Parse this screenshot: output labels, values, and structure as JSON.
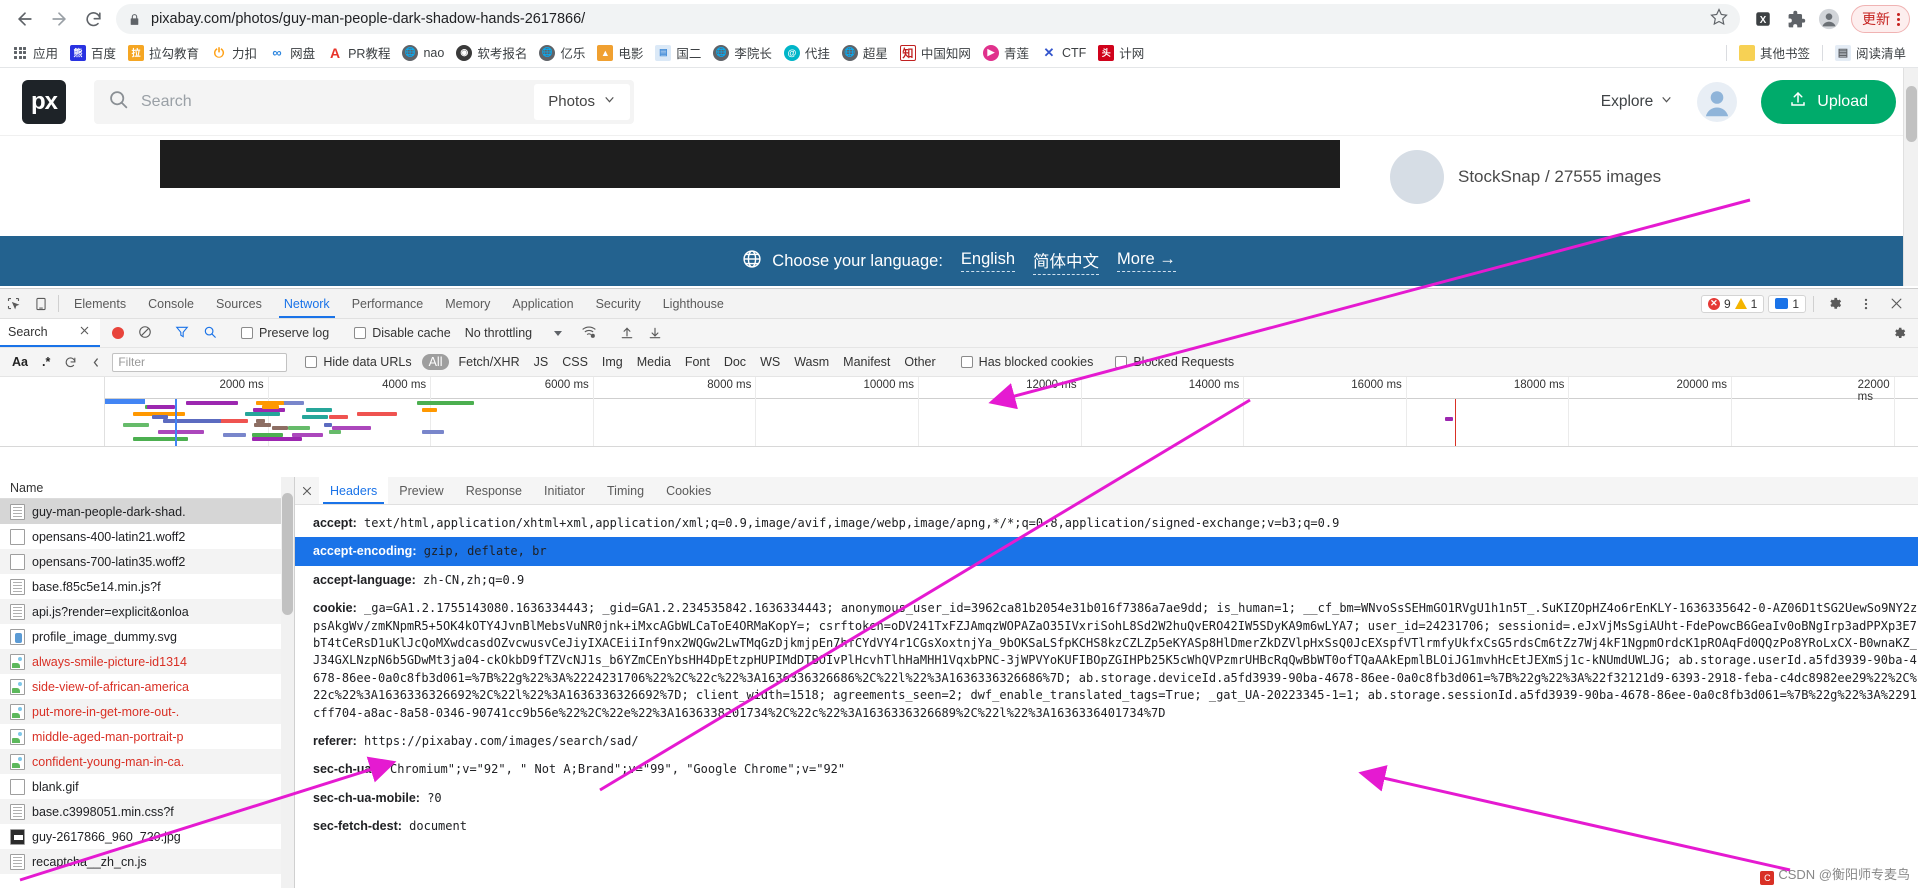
{
  "browser": {
    "back_label": "Back",
    "forward_label": "Forward",
    "reload_label": "Reload",
    "url": "pixabay.com/photos/guy-man-people-dark-shadow-hands-2617866/",
    "star_label": "Bookmark this tab",
    "update_label": "更新",
    "extensions_label": "Extensions",
    "profile_label": "Profile"
  },
  "bookmarks": {
    "items": [
      {
        "label": "应用",
        "icon": "apps-grid-icon",
        "color": "#5f6368"
      },
      {
        "label": "百度",
        "icon": "baidu-icon",
        "color": "#2932e1"
      },
      {
        "label": "拉勾教育",
        "icon": "lagou-icon",
        "color": "#f5a623"
      },
      {
        "label": "力扣",
        "icon": "leetcode-icon",
        "color": "#ffa116"
      },
      {
        "label": "网盘",
        "icon": "baidu-pan-icon",
        "color": "#2e86de"
      },
      {
        "label": "PR教程",
        "icon": "adobe-icon",
        "color": "#e8342a"
      },
      {
        "label": "nao",
        "icon": "globe-icon",
        "color": "#5f6368"
      },
      {
        "label": "软考报名",
        "icon": "globe-dark-icon",
        "color": "#3a3a3a"
      },
      {
        "label": "亿乐",
        "icon": "globe-icon",
        "color": "#5f6368"
      },
      {
        "label": "电影",
        "icon": "folder-blue-icon",
        "color": "#f0a030"
      },
      {
        "label": "国二",
        "icon": "doc-icon",
        "color": "#4a90d9"
      },
      {
        "label": "李院长",
        "icon": "globe-icon",
        "color": "#5f6368"
      },
      {
        "label": "代挂",
        "icon": "circle-teal-icon",
        "color": "#00b5c8"
      },
      {
        "label": "超星",
        "icon": "globe-icon",
        "color": "#5f6368"
      },
      {
        "label": "中国知网",
        "icon": "cnki-icon",
        "color": "#c02020"
      },
      {
        "label": "青莲",
        "icon": "play-circle-icon",
        "color": "#e0318c"
      },
      {
        "label": "CTF",
        "icon": "x-mark-icon",
        "color": "#3355cc"
      },
      {
        "label": "计网",
        "icon": "red-badge-icon",
        "color": "#d0021b"
      }
    ],
    "other_bookmarks": "其他书签",
    "reading_list": "阅读清单"
  },
  "pixabay": {
    "logo": "px",
    "search_placeholder": "Search",
    "search_value": "",
    "media_type": "Photos",
    "explore": "Explore",
    "upload": "Upload",
    "credit": "StockSnap / 27555 images",
    "language_bar": {
      "prompt": "Choose your language:",
      "options": [
        "English",
        "简体中文",
        "More →"
      ]
    }
  },
  "devtools": {
    "tabs": [
      "Elements",
      "Console",
      "Sources",
      "Network",
      "Performance",
      "Memory",
      "Application",
      "Security",
      "Lighthouse"
    ],
    "active_tab": "Network",
    "error_count": "9",
    "warning_count": "1",
    "info_count": "1",
    "settings_label": "Settings",
    "more_label": "More options",
    "close_label": "Close DevTools",
    "toolbar": {
      "search_tab": "Search",
      "record_label": "Stop recording network log",
      "clear_label": "Clear",
      "filter_label": "Filter",
      "search_label": "Search",
      "preserve_log": "Preserve log",
      "preserve_log_checked": false,
      "disable_cache": "Disable cache",
      "disable_cache_checked": false,
      "throttling": "No throttling",
      "import_label": "Import HAR file",
      "export_label": "Export HAR file"
    },
    "filterbar": {
      "match_case": "Aa",
      "regex": ".*",
      "refresh_label": "Refresh",
      "filter_placeholder": "Filter",
      "filter_value": "",
      "hide_data_urls": "Hide data URLs",
      "hide_data_urls_checked": false,
      "types": [
        "All",
        "Fetch/XHR",
        "JS",
        "CSS",
        "Img",
        "Media",
        "Font",
        "Doc",
        "WS",
        "Wasm",
        "Manifest",
        "Other"
      ],
      "active_type": "All",
      "has_blocked_cookies": "Has blocked cookies",
      "has_blocked_cookies_checked": false,
      "blocked_requests": "Blocked Requests",
      "blocked_requests_checked": false
    },
    "overview": {
      "ticks": [
        "2000 ms",
        "4000 ms",
        "6000 ms",
        "8000 ms",
        "10000 ms",
        "12000 ms",
        "14000 ms",
        "16000 ms",
        "18000 ms",
        "20000 ms",
        "22000 ms"
      ]
    },
    "requests": {
      "column_header": "Name",
      "rows": [
        {
          "name": "guy-man-people-dark-shad.",
          "icon": "doc-icon",
          "state": "selected"
        },
        {
          "name": "opensans-400-latin21.woff2",
          "icon": "blank-icon",
          "state": "normal"
        },
        {
          "name": "opensans-700-latin35.woff2",
          "icon": "blank-icon",
          "state": "normal"
        },
        {
          "name": "base.f85c5e14.min.js?f",
          "icon": "doc-icon",
          "state": "normal"
        },
        {
          "name": "api.js?render=explicit&onloa",
          "icon": "doc-icon",
          "state": "normal"
        },
        {
          "name": "profile_image_dummy.svg",
          "icon": "svg-icon",
          "state": "normal"
        },
        {
          "name": "always-smile-picture-id1314",
          "icon": "img-icon",
          "state": "error"
        },
        {
          "name": "side-view-of-african-america",
          "icon": "img-icon",
          "state": "error"
        },
        {
          "name": "put-more-in-get-more-out-.",
          "icon": "img-icon",
          "state": "error"
        },
        {
          "name": "middle-aged-man-portrait-p",
          "icon": "img-icon",
          "state": "error"
        },
        {
          "name": "confident-young-man-in-ca.",
          "icon": "img-icon",
          "state": "error"
        },
        {
          "name": "blank.gif",
          "icon": "blank-icon",
          "state": "normal"
        },
        {
          "name": "base.c3998051.min.css?f",
          "icon": "doc-icon",
          "state": "normal"
        },
        {
          "name": "guy-2617866_960_720.jpg",
          "icon": "jpg-icon",
          "state": "normal"
        },
        {
          "name": "recaptcha__zh_cn.js",
          "icon": "doc-icon",
          "state": "normal"
        }
      ]
    },
    "detail": {
      "tabs": [
        "Headers",
        "Preview",
        "Response",
        "Initiator",
        "Timing",
        "Cookies"
      ],
      "active_tab": "Headers",
      "headers": [
        {
          "key": "accept",
          "value": "text/html,application/xhtml+xml,application/xml;q=0.9,image/avif,image/webp,image/apng,*/*;q=0.8,application/signed-exchange;v=b3;q=0.9",
          "selected": false
        },
        {
          "key": "accept-encoding",
          "value": "gzip, deflate, br",
          "selected": true
        },
        {
          "key": "accept-language",
          "value": "zh-CN,zh;q=0.9",
          "selected": false
        },
        {
          "key": "cookie",
          "value": "_ga=GA1.2.1755143080.1636334443; _gid=GA1.2.234535842.1636334443; anonymous_user_id=3962ca81b2054e31b016f7386a7ae9dd; is_human=1; __cf_bm=WNvoSsSEHmGO1RVgU1h1n5T_.SuKIZOpHZ4o6rEnKLY-1636335642-0-AZ06D1tSG2UewSo9NY2zpsAkgWv/zmKNpmR5+5OK4kOTY4JvnBlMebsVuNR0jnk+iMxcAGbWLCaToE4ORMaKopY=; csrftoken=oDV241TxFZJAmqzWOPAZaO35IVxriSohL8Sd2W2huQvERO42IW5SDyKA9m6wLYA7; user_id=24231706; sessionid=.eJxVjMsSgiAUht-FdePowcB6GeaIv0oBNgIrp3adPPXp3E7bT4tCeRsD1uKlJcQoMXwdcasdOZvcwusvCeJiyIXACEiiInf9nx2WQGw2LwTMqGzDjkmjpEn7hfCYdVY4r1CGsXoxtnjYa_9bOKSaLSfpKCHS8kzCZLZp5eKYASp8HlDmerZkDZVlpHxSsQ0JcEXspfVTlrmfyUkfxCsG5rdsCm6tZz7Wj4kF1NgpmOrdcK1pROAqFd0QQzPo8YRoLxCX-B0wnaKZ_J34GXLNzpN6b5GDwMt3ja04-ckOkbD9fTZVcNJ1s_b6YZmCEnYbsHH4DpEtzpHUPIMdDTBOIvPlHcvhTlhHaMHH1VqxbPNC-3jWPVYoKUFIBOpZGIHPb25K5cWhQVPzmrUHBcRqQwBbWT0ofTQaAAkEpmlBLOiJG1mvhHcEtJEXmSj1c-kNUmdUWLJG; ab.storage.userId.a5fd3939-90ba-4678-86ee-0a0c8fb3d061=%7B%22g%22%3A%2224231706%22%2C%22c%22%3A1636336326686%2C%22l%22%3A1636336326686%7D; ab.storage.deviceId.a5fd3939-90ba-4678-86ee-0a0c8fb3d061=%7B%22g%22%3A%22f32121d9-6393-2918-feba-c4dc8982ee29%22%2C%22c%22%3A1636336326692%2C%22l%22%3A1636336326692%7D; client_width=1518; agreements_seen=2; dwf_enable_translated_tags=True; _gat_UA-20223345-1=1; ab.storage.sessionId.a5fd3939-90ba-4678-86ee-0a0c8fb3d061=%7B%22g%22%3A%2291cff704-a8ac-8a58-0346-90741cc9b56e%22%2C%22e%22%3A1636338201734%2C%22c%22%3A1636336326689%2C%22l%22%3A1636336401734%7D",
          "selected": false
        },
        {
          "key": "referer",
          "value": "https://pixabay.com/images/search/sad/",
          "selected": false
        },
        {
          "key": "sec-ch-ua",
          "value": "\"Chromium\";v=\"92\", \" Not A;Brand\";v=\"99\", \"Google Chrome\";v=\"92\"",
          "selected": false
        },
        {
          "key": "sec-ch-ua-mobile",
          "value": "?0",
          "selected": false
        },
        {
          "key": "sec-fetch-dest",
          "value": "document",
          "selected": false
        }
      ]
    }
  },
  "watermark": "CSDN @衡阳师专麦鸟"
}
